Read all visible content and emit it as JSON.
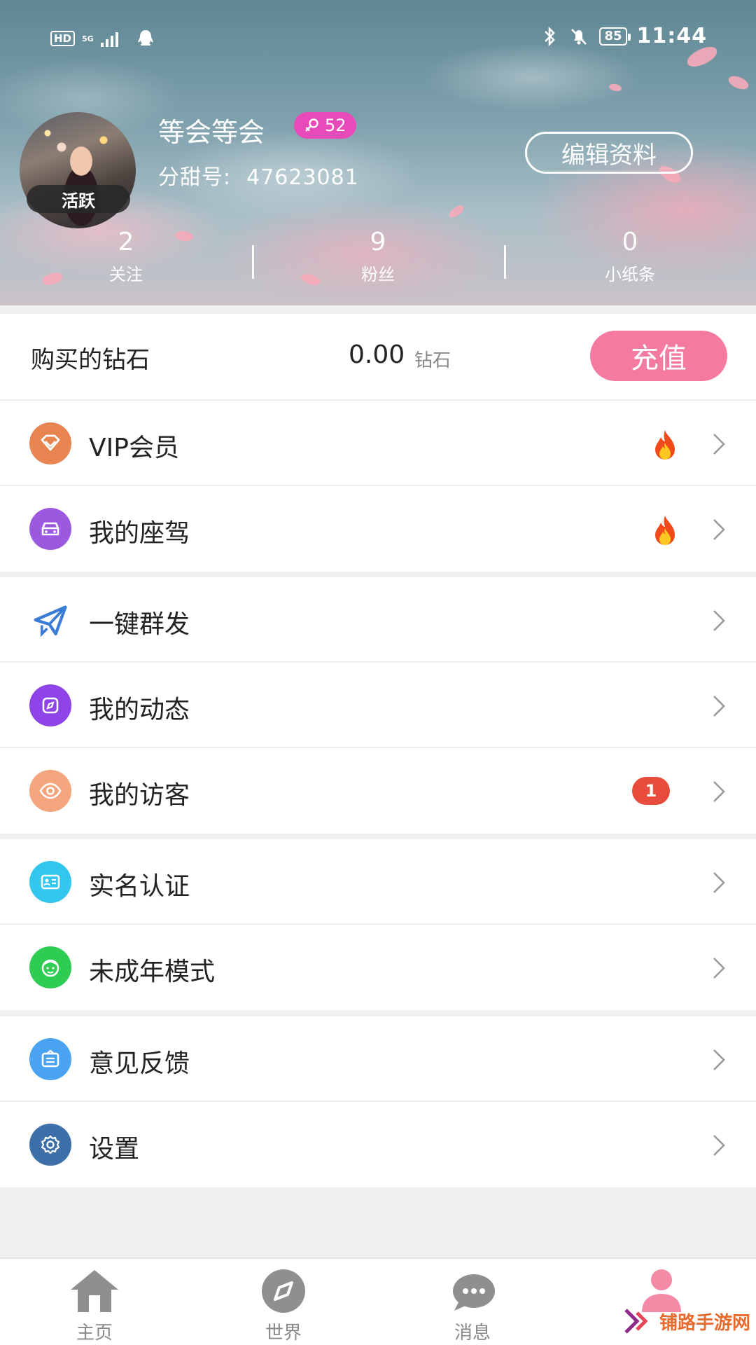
{
  "status_bar": {
    "hd": "HD",
    "network": "5G",
    "battery": "85",
    "time": "11:44"
  },
  "profile": {
    "username": "等会等会",
    "level": "52",
    "active_tag": "活跃",
    "uid_label": "分甜号:",
    "uid_value": "47623081",
    "edit_button": "编辑资料"
  },
  "stats": [
    {
      "value": "2",
      "label": "关注"
    },
    {
      "value": "9",
      "label": "粉丝"
    },
    {
      "value": "0",
      "label": "小纸条"
    }
  ],
  "diamonds": {
    "label": "购买的钻石",
    "amount": "0.00",
    "unit": "钻石",
    "recharge_button": "充值"
  },
  "menu": [
    {
      "label": "VIP会员",
      "icon": "diamond-icon",
      "color": "#e8844f",
      "hot": true
    },
    {
      "label": "我的座驾",
      "icon": "car-icon",
      "color": "#9b59e0",
      "hot": true
    },
    {
      "label": "一键群发",
      "icon": "paper-plane-icon",
      "color": "#3a7bd5"
    },
    {
      "label": "我的动态",
      "icon": "compass-icon",
      "color": "#8e44e8"
    },
    {
      "label": "我的访客",
      "icon": "eye-icon",
      "color": "#f5a57d",
      "badge": "1"
    },
    {
      "label": "实名认证",
      "icon": "id-card-icon",
      "color": "#33c6ef"
    },
    {
      "label": "未成年模式",
      "icon": "child-face-icon",
      "color": "#2ecc52"
    },
    {
      "label": "意见反馈",
      "icon": "feedback-icon",
      "color": "#4aa3f2"
    },
    {
      "label": "设置",
      "icon": "gear-icon",
      "color": "#3d6fa8"
    }
  ],
  "bottom_nav": [
    {
      "label": "主页",
      "icon": "home-icon"
    },
    {
      "label": "世界",
      "icon": "compass-icon"
    },
    {
      "label": "消息",
      "icon": "chat-bubbles-icon"
    },
    {
      "label": "",
      "icon": "profile-icon",
      "active": true
    }
  ],
  "watermark": "铺路手游网"
}
